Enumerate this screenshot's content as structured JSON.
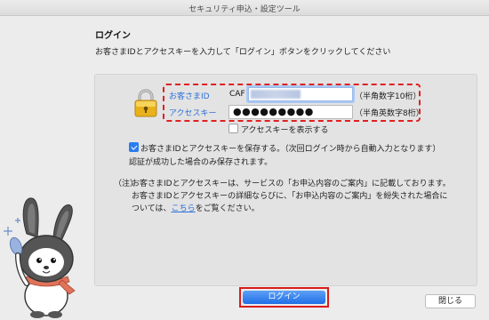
{
  "window": {
    "title": "セキュリティ申込・設定ツール"
  },
  "heading": "ログイン",
  "instruction": "お客さまIDとアクセスキーを入力して「ログイン」ボタンをクリックしてください",
  "form": {
    "customer_id_label": "お客さまID",
    "customer_id_prefix": "CAF",
    "customer_id_hint": "（半角数字10桁）",
    "access_key_label": "アクセスキー",
    "access_key_value": "●●●●●●●●●",
    "access_key_hint": "（半角英数字8桁）",
    "show_key_label": "アクセスキーを表示する",
    "show_key_checked": false
  },
  "save_option": {
    "label": "お客さまIDとアクセスキーを保存する。（次回ログイン時から自動入力となります）",
    "note": "認証が成功した場合のみ保存されます。",
    "checked": true
  },
  "notice": {
    "prefix": "（注）",
    "line1": "お客さまIDとアクセスキーは、サービスの「お申込内容のご案内」に記載しております。",
    "line2": "お客さまIDとアクセスキーの詳細ならびに、「お申込内容のご案内」を紛失された場合に",
    "line3_before": "ついては、",
    "line3_link": "こちら",
    "line3_after": "をご覧ください。"
  },
  "buttons": {
    "login": "ログイン",
    "close": "閉じる"
  },
  "colors": {
    "accent": "#2a7cf2",
    "highlight": "#e02020",
    "link": "#2c6fd8"
  },
  "icons": {
    "lock": "lock-icon",
    "mascot": "rabbit-mascot"
  }
}
